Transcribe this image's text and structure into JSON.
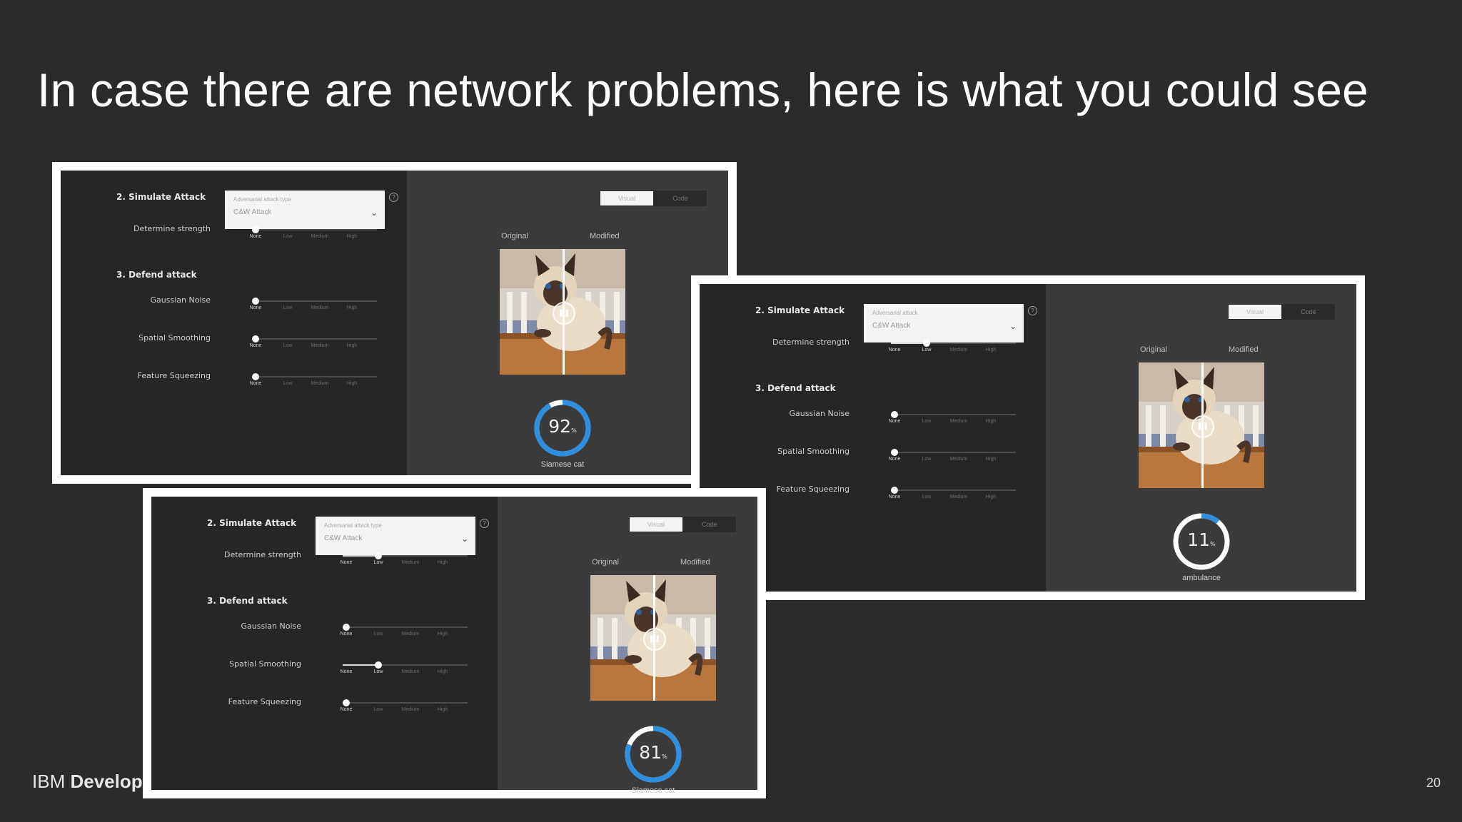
{
  "slide": {
    "title": "In case there are network problems, here is what you could see",
    "brand_light": "IBM ",
    "brand_bold": "Develop",
    "page_number": "20"
  },
  "screenshots": [
    {
      "simulate_heading": "2. Simulate Attack",
      "dropdown_label": "Adversarial attack type",
      "dropdown_value": "C&W Attack",
      "defend_heading": "3. Defend attack",
      "controls": [
        {
          "label": "Determine strength",
          "level": 0
        },
        {
          "label": "Gaussian Noise",
          "level": 0
        },
        {
          "label": "Spatial Smoothing",
          "level": 0
        },
        {
          "label": "Feature Squeezing",
          "level": 0
        }
      ],
      "toggle": [
        "Visual",
        "Code"
      ],
      "original_label": "Original",
      "modified_label": "Modified",
      "confidence": "92",
      "confidence_unit": "%",
      "confidence_fraction": 0.92,
      "prediction": "Siamese cat"
    },
    {
      "simulate_heading": "2. Simulate Attack",
      "dropdown_label": "Adversarial attack",
      "dropdown_value": "C&W Attack",
      "defend_heading": "3. Defend attack",
      "controls": [
        {
          "label": "Determine strength",
          "level": 1
        },
        {
          "label": "Gaussian Noise",
          "level": 0
        },
        {
          "label": "Spatial Smoothing",
          "level": 0
        },
        {
          "label": "Feature Squeezing",
          "level": 0
        }
      ],
      "toggle": [
        "Visual",
        "Code"
      ],
      "original_label": "Original",
      "modified_label": "Modified",
      "confidence": "11",
      "confidence_unit": "%",
      "confidence_fraction": 0.11,
      "prediction": "ambulance"
    },
    {
      "simulate_heading": "2. Simulate Attack",
      "dropdown_label": "Adversarial attack type",
      "dropdown_value": "C&W Attack",
      "defend_heading": "3. Defend attack",
      "controls": [
        {
          "label": "Determine strength",
          "level": 1
        },
        {
          "label": "Gaussian Noise",
          "level": 0
        },
        {
          "label": "Spatial Smoothing",
          "level": 1
        },
        {
          "label": "Feature Squeezing",
          "level": 0
        }
      ],
      "toggle": [
        "Visual",
        "Code"
      ],
      "original_label": "Original",
      "modified_label": "Modified",
      "confidence": "81",
      "confidence_unit": "%",
      "confidence_fraction": 0.81,
      "prediction": "Siamese cat"
    }
  ],
  "slider_ticks": [
    "None",
    "Low",
    "Medium",
    "High"
  ],
  "colors": {
    "ring_accent": "#2d8fe0",
    "ring_track": "#ffffff"
  }
}
